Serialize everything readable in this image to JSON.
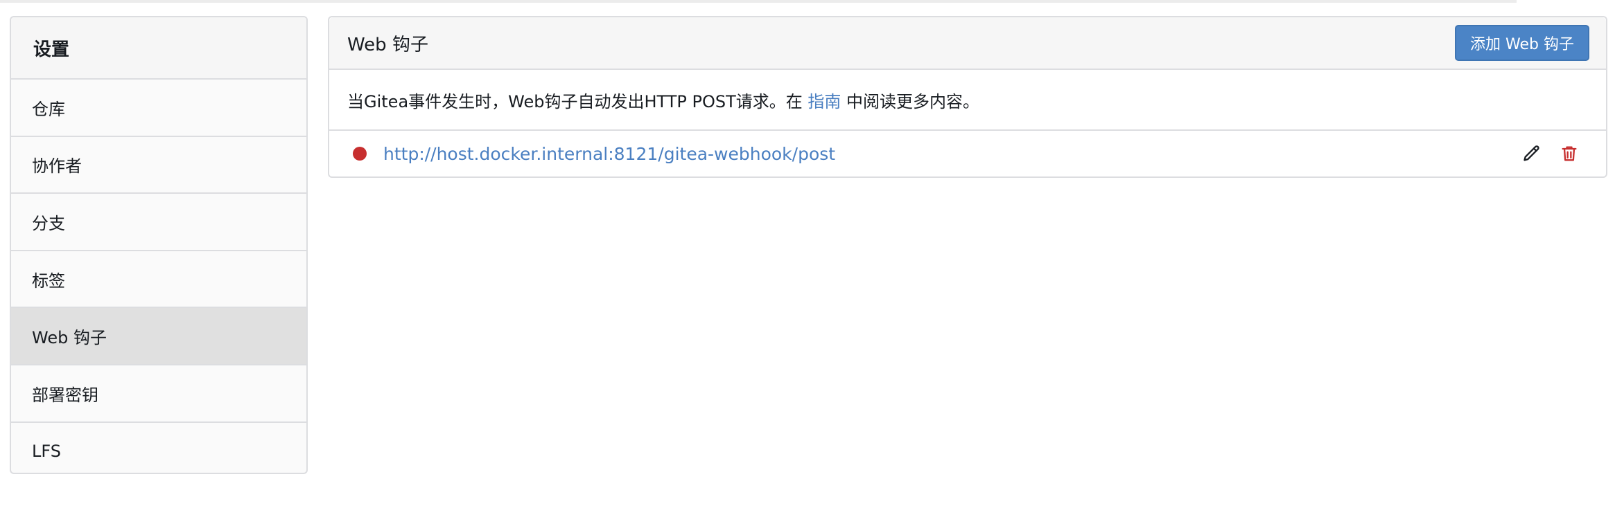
{
  "sidebar": {
    "title": "设置",
    "items": [
      {
        "label": "仓库",
        "active": false
      },
      {
        "label": "协作者",
        "active": false
      },
      {
        "label": "分支",
        "active": false
      },
      {
        "label": "标签",
        "active": false
      },
      {
        "label": "Web 钩子",
        "active": true
      },
      {
        "label": "部署密钥",
        "active": false
      },
      {
        "label": "LFS",
        "active": false
      }
    ]
  },
  "main": {
    "title": "Web 钩子",
    "add_button_label": "添加 Web 钩子",
    "description": {
      "prefix": "当Gitea事件发生时，Web钩子自动发出HTTP POST请求。在 ",
      "link_text": "指南",
      "suffix": " 中阅读更多内容。"
    },
    "webhooks": [
      {
        "url": "http://host.docker.internal:8121/gitea-webhook/post",
        "status": "failed",
        "status_color": "#c72f2f"
      }
    ]
  },
  "colors": {
    "accent": "#4b84c6",
    "link": "#4a7fc1",
    "danger": "#c72f2f"
  }
}
